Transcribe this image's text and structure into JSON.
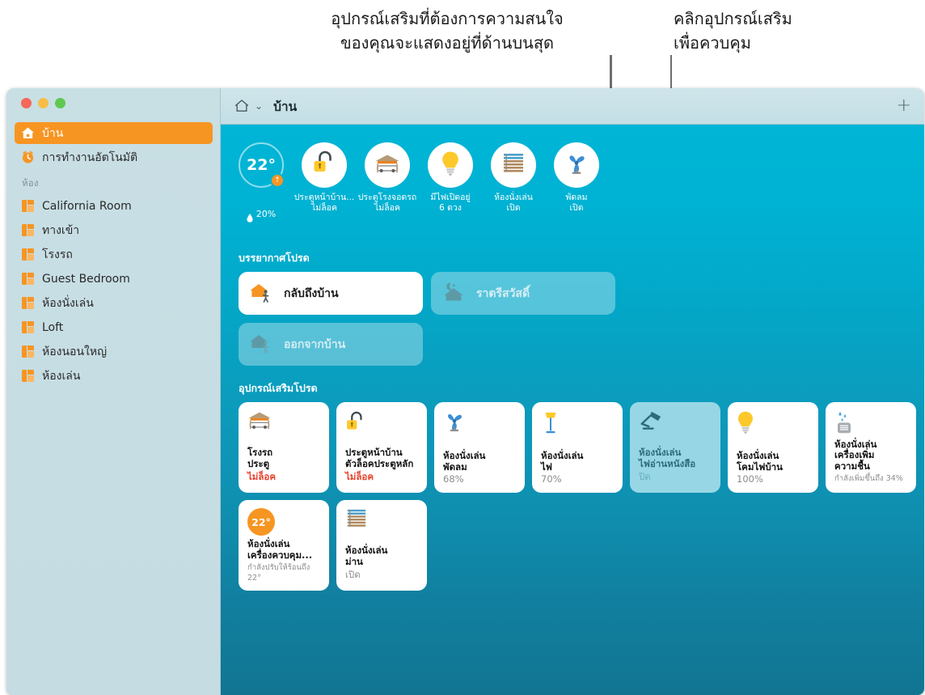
{
  "annotations": {
    "left": "อุปกรณ์เสริมที่ต้องการความสนใจ\nของคุณจะแสดงอยู่ที่ด้านบนสุด",
    "right": "คลิกอุปกรณ์เสริม\nเพื่อควบคุม"
  },
  "window": {
    "traffic_lights": [
      "close",
      "minimize",
      "zoom"
    ]
  },
  "sidebar": {
    "items": [
      {
        "label": "บ้าน",
        "icon": "home-icon",
        "selected": true
      },
      {
        "label": "การทำงานอัตโนมัติ",
        "icon": "automation-icon",
        "selected": false
      }
    ],
    "rooms_heading": "ห้อง",
    "rooms": [
      {
        "label": "California Room",
        "icon": "room-icon"
      },
      {
        "label": "ทางเข้า",
        "icon": "room-icon"
      },
      {
        "label": "โรงรถ",
        "icon": "room-icon"
      },
      {
        "label": "Guest Bedroom",
        "icon": "room-icon"
      },
      {
        "label": "ห้องนั่งเล่น",
        "icon": "room-icon"
      },
      {
        "label": "Loft",
        "icon": "room-icon"
      },
      {
        "label": "ห้องนอนใหญ่",
        "icon": "room-icon"
      },
      {
        "label": "ห้องเล่น",
        "icon": "room-icon"
      }
    ]
  },
  "titlebar": {
    "home_icon": "home-outline-icon",
    "chevron": "⌄",
    "title": "บ้าน",
    "add_label": "+"
  },
  "status_row": [
    {
      "type": "temperature",
      "value": "22°",
      "badge": "↑",
      "humidity": "20%",
      "caption": ""
    },
    {
      "type": "lock",
      "icon": "lock-open-icon",
      "caption": "ประตูหน้าบ้าน...\nไม่ล็อค"
    },
    {
      "type": "garage",
      "icon": "garage-open-icon",
      "caption": "ประตูโรงจอดรถ\nไม่ล็อค"
    },
    {
      "type": "light",
      "icon": "lightbulb-icon",
      "caption": "มีไฟเปิดอยู่\n6 ดวง"
    },
    {
      "type": "blinds",
      "icon": "blinds-icon",
      "caption": "ห้องนั่งเล่น\nเปิด"
    },
    {
      "type": "fan",
      "icon": "fan-icon",
      "caption": "พัดลม\nเปิด"
    }
  ],
  "scenes": {
    "title": "บรรยากาศโปรด",
    "items": [
      {
        "label": "กลับถึงบ้าน",
        "icon": "house-arrive-icon",
        "active": true
      },
      {
        "label": "ราตรีสวัสดิ์",
        "icon": "house-night-icon",
        "active": false
      },
      {
        "label": "ออกจากบ้าน",
        "icon": "house-leave-icon",
        "active": false
      }
    ]
  },
  "accessories": {
    "title": "อุปกรณ์เสริมโปรด",
    "items": [
      {
        "icon": "garage-icon",
        "name": "โรงรถ\nประตู",
        "state": "ไม่ล็อค",
        "state_style": "alert",
        "selected": false
      },
      {
        "icon": "lock-open-icon",
        "name": "ประตูหน้าบ้าน\nตัวล็อคประตูหลัก",
        "state": "ไม่ล็อค",
        "state_style": "alert",
        "selected": false
      },
      {
        "icon": "fan-icon",
        "name": "ห้องนั่งเล่น\nพัดลม",
        "state": "68%",
        "state_style": "normal",
        "selected": false
      },
      {
        "icon": "floor-lamp-icon",
        "name": "ห้องนั่งเล่น\nไฟ",
        "state": "70%",
        "state_style": "normal",
        "selected": false
      },
      {
        "icon": "desk-lamp-icon",
        "name": "ห้องนั่งเล่น\nไฟอ่านหนังสือ",
        "state": "ปิด",
        "state_style": "normal",
        "selected": true
      },
      {
        "icon": "lightbulb-icon",
        "name": "ห้องนั่งเล่น\nโคมไฟบ้าน",
        "state": "100%",
        "state_style": "normal",
        "selected": false
      },
      {
        "icon": "humidifier-icon",
        "name": "ห้องนั่งเล่น\nเครื่องเพิ่มความชื้น",
        "state": "กำลังเพิ่มขึ้นถึง 34%",
        "state_style": "small",
        "selected": false
      },
      {
        "icon": "thermostat-icon",
        "icon_value": "22°",
        "name": "ห้องนั่งเล่น\nเครื่องควบคุม...",
        "state": "กำลังปรับให้ร้อนถึง 22°",
        "state_style": "small",
        "selected": false
      },
      {
        "icon": "blinds-icon",
        "name": "ห้องนั่งเล่น\nม่าน",
        "state": "เปิด",
        "state_style": "normal",
        "selected": false
      }
    ]
  },
  "colors": {
    "accent_orange": "#f79522",
    "sidebar_bg": "#c6dde3",
    "content_top": "#00b5d6",
    "content_bottom": "#117592",
    "alert_red": "#e8402a",
    "selected_tile": "#97d7e5"
  }
}
